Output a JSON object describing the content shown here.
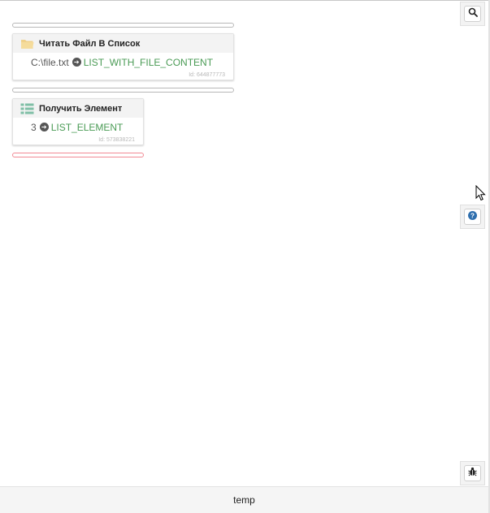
{
  "blocks": [
    {
      "title": "Читать Файл В Список",
      "icon": "folder-icon",
      "param": "C:\\file.txt",
      "output": "LIST_WITH_FILE_CONTENT",
      "id_text": "Id: 644877773"
    },
    {
      "title": "Получить Элемент",
      "icon": "list-icon",
      "param": "3",
      "output": "LIST_ELEMENT",
      "id_text": "Id: 573838221"
    }
  ],
  "sidebar": {
    "search": "search-icon",
    "help": "help-icon",
    "debug": "bug-icon"
  },
  "footer": {
    "label": "temp"
  },
  "colors": {
    "output_variable": "#4a9b55",
    "error_zone": "#f28a94",
    "folder": "#f0d18a",
    "list_icon": "#7fbfa6"
  }
}
